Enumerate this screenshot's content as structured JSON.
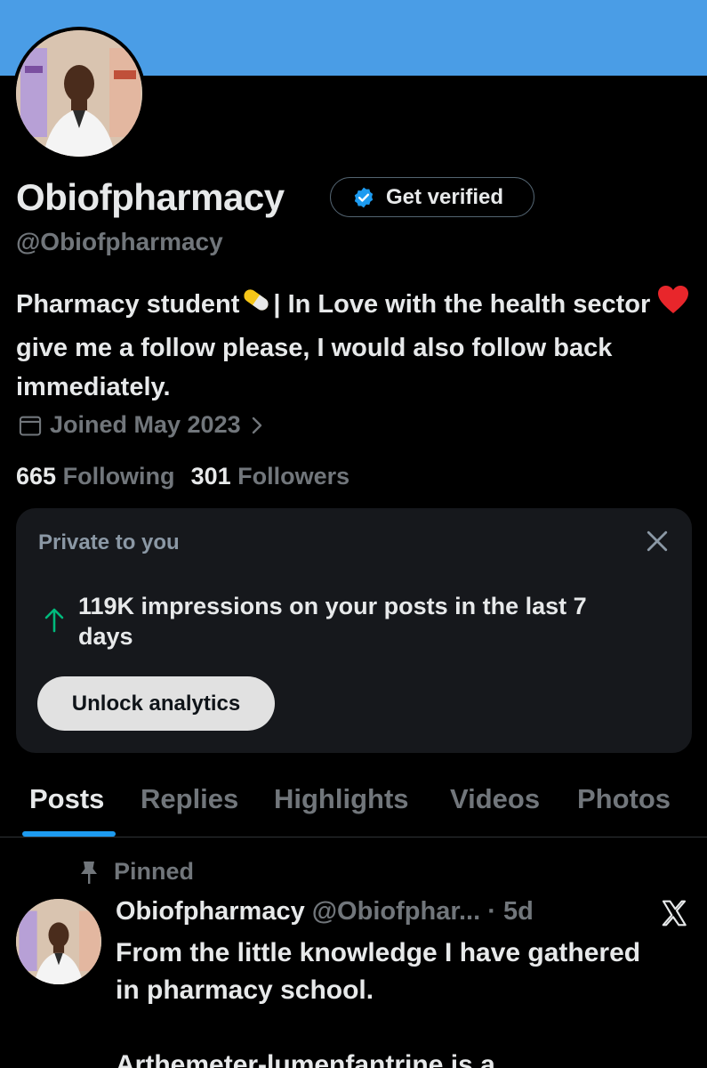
{
  "profile": {
    "name": "Obiofpharmacy",
    "handle": "@Obiofpharmacy",
    "get_verified_label": "Get verified",
    "bio_part1": "Pharmacy student",
    "bio_part2": "| In Love with the health sector",
    "bio_part3": "give me a follow please, I would also follow back immediately.",
    "joined": "Joined May 2023",
    "following_count": "665",
    "following_label": "Following",
    "followers_count": "301",
    "followers_label": "Followers"
  },
  "private_card": {
    "title": "Private to you",
    "impressions_text": "119K impressions on your posts in the last 7 days",
    "unlock_label": "Unlock analytics"
  },
  "tabs": [
    {
      "label": "Posts",
      "active": true
    },
    {
      "label": "Replies"
    },
    {
      "label": "Highlights"
    },
    {
      "label": "Videos"
    },
    {
      "label": "Photos"
    }
  ],
  "post": {
    "pinned_label": "Pinned",
    "author_name": "Obiofpharmacy",
    "author_handle": "@Obiofphar... · 5d",
    "body": "From the little knowledge I have gathered in pharmacy school.\n\nArthemeter-lumenfantrine is a"
  },
  "colors": {
    "banner": "#4a9de6",
    "accent": "#1d9bf0",
    "verified_blue": "#1d9bf0",
    "impressions_arrow": "#00ba7c"
  },
  "icons": [
    "verified-badge-icon",
    "calendar-icon",
    "chevron-right-icon",
    "close-icon",
    "arrow-up-icon",
    "pin-icon",
    "x-logo-icon",
    "pill-emoji-icon",
    "heart-emoji-icon"
  ]
}
